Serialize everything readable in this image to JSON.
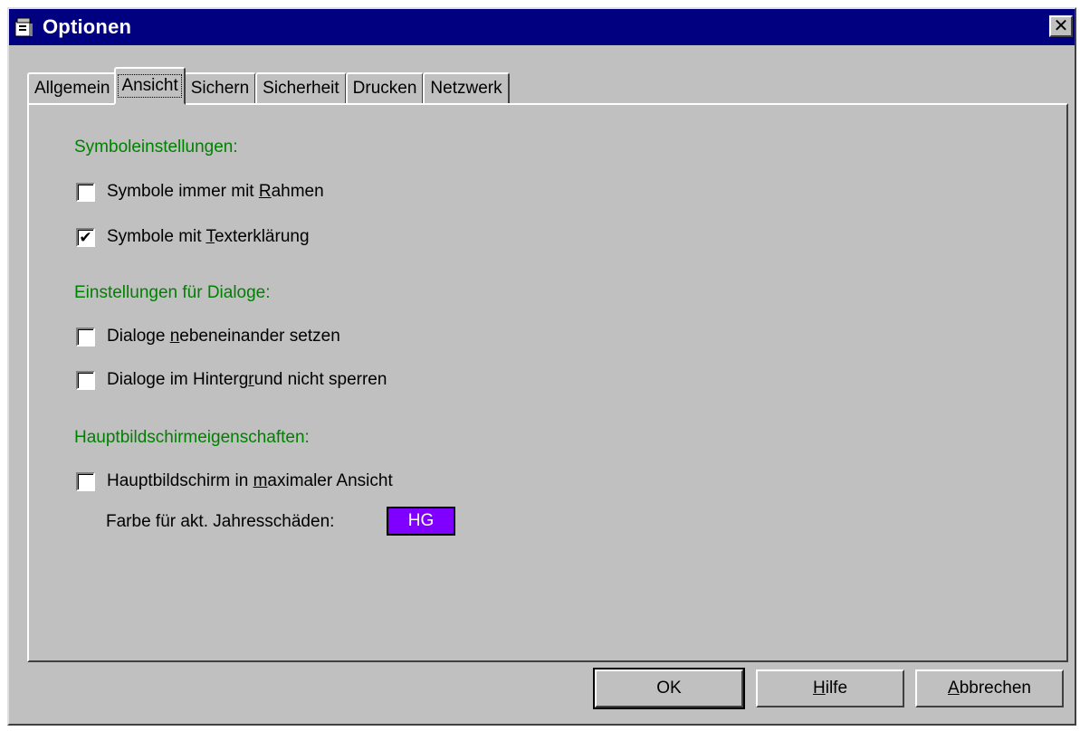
{
  "window": {
    "title": "Optionen",
    "icon": "binder-icon",
    "close_label": "✕"
  },
  "tabs": [
    {
      "label": "Allgemein",
      "active": false
    },
    {
      "label": "Ansicht",
      "active": true
    },
    {
      "label": "Sichern",
      "active": false
    },
    {
      "label": "Sicherheit",
      "active": false
    },
    {
      "label": "Drucken",
      "active": false
    },
    {
      "label": "Netzwerk",
      "active": false
    }
  ],
  "sections": {
    "symbols": {
      "heading": "Symboleinstellungen:",
      "options": [
        {
          "pre": "Symbole immer mit ",
          "accel": "R",
          "post": "ahmen",
          "checked": false
        },
        {
          "pre": "Symbole mit ",
          "accel": "T",
          "post": "exterklärung",
          "checked": true
        }
      ]
    },
    "dialogs": {
      "heading": "Einstellungen für Dialoge:",
      "options": [
        {
          "pre": "Dialoge ",
          "accel": "n",
          "post": "ebeneinander setzen",
          "checked": false
        },
        {
          "pre": "Dialoge im Hinterg",
          "accel": "r",
          "post": "und nicht sperren",
          "checked": false
        }
      ]
    },
    "main_screen": {
      "heading": "Hauptbildschirmeigenschaften:",
      "options": [
        {
          "pre": "Hauptbildschirm in ",
          "accel": "m",
          "post": "aximaler Ansicht",
          "checked": false
        }
      ],
      "color_label": "Farbe für akt. Jahresschäden:",
      "color_swatch_text": "HG",
      "color_swatch_color": "#8000ff"
    }
  },
  "buttons": {
    "ok": {
      "pre": "",
      "accel": "",
      "post": "OK"
    },
    "help": {
      "pre": "",
      "accel": "H",
      "post": "ilfe"
    },
    "cancel": {
      "pre": "",
      "accel": "A",
      "post": "bbrechen"
    }
  },
  "colors": {
    "title_bar": "#000080",
    "face": "#c0c0c0",
    "heading_green": "#008000"
  }
}
